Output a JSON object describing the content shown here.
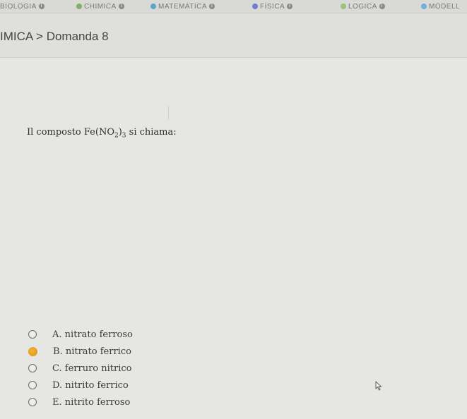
{
  "tabs": [
    {
      "label": "BIOLOGIA",
      "dot_color": "",
      "info_icon": "info-icon"
    },
    {
      "label": "CHIMICA",
      "dot_color": "#7fb06a",
      "info_icon": "info-icon"
    },
    {
      "label": "MATEMATICA",
      "dot_color": "#5aa8c8",
      "info_icon": "info-icon"
    },
    {
      "label": "FISICA",
      "dot_color": "#6a7fd0",
      "info_icon": "info-icon"
    },
    {
      "label": "LOGICA",
      "dot_color": "#9bc27a",
      "info_icon": "info-icon"
    },
    {
      "label": "MODELL",
      "dot_color": "#6fb0d8",
      "info_icon": ""
    }
  ],
  "breadcrumb": {
    "section": "IMICA",
    "separator": ">",
    "item": "Domanda 8"
  },
  "question": {
    "prefix": "Il composto ",
    "formula_base": "Fe(NO",
    "formula_sub1": "2",
    "formula_close": ")",
    "formula_sub2": "3",
    "suffix": " si chiama:"
  },
  "options": [
    {
      "letter": "A.",
      "text": "nitrato ferroso",
      "selected": false
    },
    {
      "letter": "B.",
      "text": "nitrato ferrico",
      "selected": true
    },
    {
      "letter": "C.",
      "text": "ferruro nitrico",
      "selected": false
    },
    {
      "letter": "D.",
      "text": "nitrito ferrico",
      "selected": false
    },
    {
      "letter": "E.",
      "text": "nitrito ferroso",
      "selected": false
    }
  ],
  "colors": {
    "selected_radio": "#e39a1d"
  }
}
